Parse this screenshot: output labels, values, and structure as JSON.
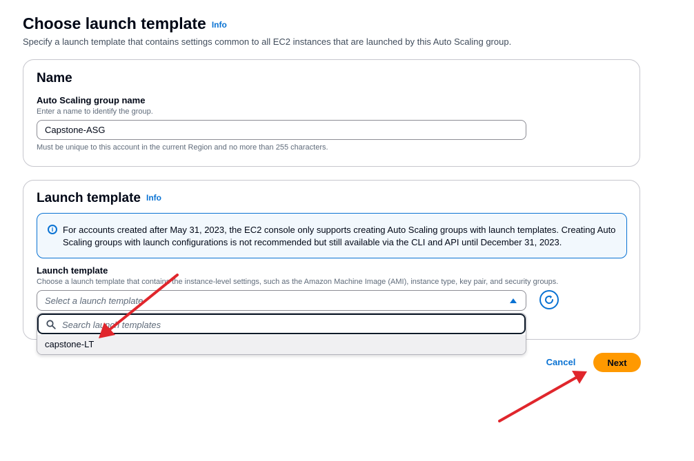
{
  "header": {
    "title": "Choose launch template",
    "info": "Info",
    "description": "Specify a launch template that contains settings common to all EC2 instances that are launched by this Auto Scaling group."
  },
  "name_panel": {
    "title": "Name",
    "field_label": "Auto Scaling group name",
    "field_description": "Enter a name to identify the group.",
    "field_value": "Capstone-ASG",
    "constraint": "Must be unique to this account in the current Region and no more than 255 characters."
  },
  "launch_panel": {
    "title": "Launch template",
    "info": "Info",
    "alert": "For accounts created after May 31, 2023, the EC2 console only supports creating Auto Scaling groups with launch templates. Creating Auto Scaling groups with launch configurations is not recommended but still available via the CLI and API until December 31, 2023.",
    "field_label": "Launch template",
    "field_description": "Choose a launch template that contains the instance-level settings, such as the Amazon Machine Image (AMI), instance type, key pair, and security groups.",
    "select_placeholder": "Select a launch template",
    "search_placeholder": "Search launch templates",
    "options": [
      "capstone-LT"
    ]
  },
  "actions": {
    "cancel": "Cancel",
    "next": "Next"
  },
  "colors": {
    "link": "#0972d3",
    "primary_button": "#ff9900",
    "annotation_arrow": "#e0262c"
  },
  "icons": {
    "info_alert": "info-circle-icon",
    "refresh": "refresh-icon",
    "search": "search-icon",
    "caret": "caret-up-icon"
  }
}
